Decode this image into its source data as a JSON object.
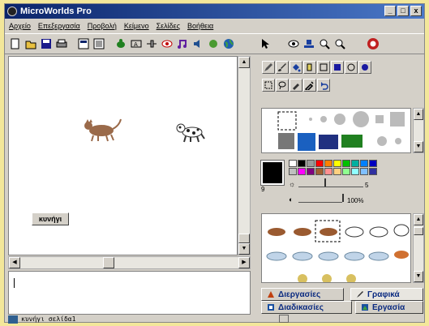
{
  "window": {
    "title": "MicroWorlds Pro",
    "min": "_",
    "max": "□",
    "close": "x"
  },
  "menu": [
    "Αρχείο",
    "Επεξεργασία",
    "Προβολή",
    "Κείμενο",
    "Σελίδες",
    "Βοήθεια"
  ],
  "page": {
    "button_label": "κυνήγι"
  },
  "statusbar": {
    "text": "κυνήγι σελίδα1"
  },
  "palette": {
    "color_number": "9",
    "shade_value": "5",
    "opacity_value": "100%",
    "swatches": [
      "#ffffff",
      "#000000",
      "#9a9a9a",
      "#ff0000",
      "#ff8000",
      "#ffff00",
      "#00c000",
      "#00b0a0",
      "#0080ff",
      "#0000c0",
      "#c0c0c0",
      "#ff00ff",
      "#800080",
      "#a06030",
      "#ff9090",
      "#ffd080",
      "#90ff90",
      "#90ffff",
      "#80c0ff",
      "#3030a0"
    ]
  },
  "tabs": {
    "processes": "Διεργασίες",
    "graphics": "Γραφικά",
    "procedures": "Διαδικασίες",
    "project": "Εργασία"
  }
}
